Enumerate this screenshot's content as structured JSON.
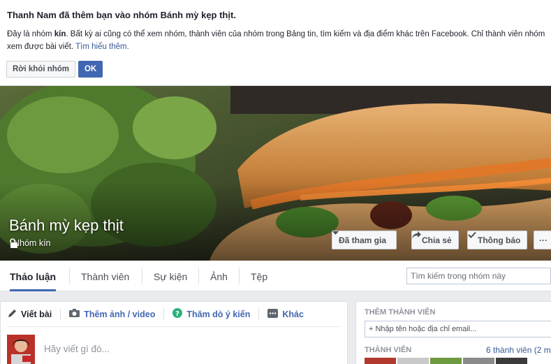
{
  "notice": {
    "title": "Thanh Nam đã thêm bạn vào nhóm Bánh mỳ kẹp thịt.",
    "text_before": "Đây là nhóm ",
    "text_bold": "kín",
    "text_after": ". Bất kỳ ai cũng có thể xem nhóm, thành viên của nhóm trong Bảng tin, tìm kiếm và địa điểm khác trên Facebook. Chỉ thành viên nhóm xem được bài viết. ",
    "learn_more": "Tìm hiểu thêm.",
    "leave_label": "Rời khỏi nhóm",
    "ok_label": "OK"
  },
  "cover": {
    "group_name": "Bánh mỳ kẹp thịt",
    "privacy": "Nhóm kín",
    "joined_label": "Đã tham gia",
    "share_label": "Chia sẻ",
    "notify_label": "Thông báo",
    "more_label": "···"
  },
  "tabs": [
    {
      "label": "Thảo luận"
    },
    {
      "label": "Thành viên"
    },
    {
      "label": "Sự kiện"
    },
    {
      "label": "Ảnh"
    },
    {
      "label": "Tệp"
    }
  ],
  "search": {
    "placeholder": "Tìm kiếm trong nhóm này"
  },
  "composer": {
    "tabs": [
      {
        "label": "Viết bài"
      },
      {
        "label": "Thêm ảnh / video"
      },
      {
        "label": "Thăm dò ý kiến"
      },
      {
        "label": "Khác"
      }
    ],
    "placeholder": "Hãy viết gì đó..."
  },
  "right_panel": {
    "add_members_title": "THÊM THÀNH VIÊN",
    "add_members_placeholder": "+ Nhập tên hoặc địa chỉ email...",
    "members_title": "THÀNH VIÊN",
    "members_count": "6 thành viên (2 m"
  },
  "colors": {
    "brand": "#4267b2",
    "link": "#365899"
  }
}
